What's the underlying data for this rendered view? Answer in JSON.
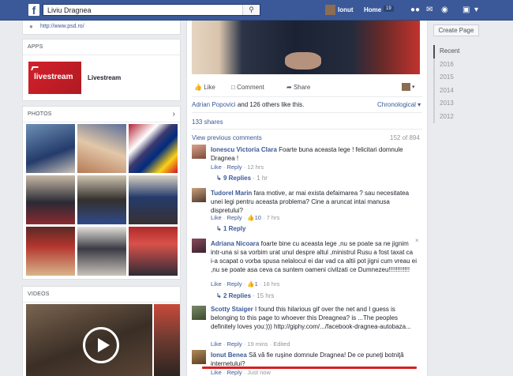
{
  "topbar": {
    "logo": "f",
    "search_value": "Liviu Dragnea",
    "user_name": "Ionut",
    "home_label": "Home",
    "home_count": "19",
    "icons": [
      "friends-icon",
      "messages-icon",
      "globe-icon",
      "lock-icon",
      "caret-down-icon"
    ]
  },
  "left": {
    "url": "http://www.psd.ro/",
    "apps_header": "APPS",
    "app_logo_text": "livestream",
    "app_name": "Livestream",
    "photos_header": "PHOTOS",
    "videos_header": "VIDEOS"
  },
  "post": {
    "actions": {
      "like": "Like",
      "comment": "Comment",
      "share": "Share"
    },
    "likers_name": "Adrian Popovici",
    "likers_rest": " and 126 others like this.",
    "order_label": "Chronological ▾",
    "shares": "133 shares",
    "view_previous": "View previous comments",
    "count": "152 of 894",
    "comments": [
      {
        "name": "Ionescu Victoria Clara",
        "text": "Foarte buna aceasta lege ! felicitari domnule Dragnea !",
        "meta_like": "Like",
        "meta_reply": "Reply",
        "meta_time": "12 hrs",
        "replies": "9 Replies",
        "replies_time": "1 hr"
      },
      {
        "name": "Tudorel Marin",
        "text": "fara motive, ar mai exista defaimarea ? sau necesitatea unei legi pentru aceasta problema? Cine a aruncat intai manusa dispretului?",
        "meta_like": "Like",
        "meta_reply": "Reply",
        "meta_likes": "10",
        "meta_time": "7 hrs",
        "replies": "1 Reply"
      },
      {
        "name": "Adriana Nicoara",
        "text": "foarte bine cu aceasta lege ,nu se poate sa ne jignim intr-una si sa vorbim urat unul despre altul ,ministrul Rusu a fost taxat ca i-a scapat o vorba spusa nelalocul ei dar vad ca altii pot jigni cum vreau ei ,nu se poate asa ceva ca suntem oameni civilzati ce Dumnezeu!!!!!!!!!!!!",
        "meta_like": "Like",
        "meta_reply": "Reply",
        "meta_likes": "1",
        "meta_time": "16 hrs",
        "replies": "2 Replies",
        "replies_time": "15 hrs"
      },
      {
        "name": "Scotty Staiger",
        "text": "I found this hilarious gif over the net and I guess is belonging to this page to whoever this Dreagnea? is ...The peoples definitely loves you:))) http://giphy.com/.../facebook-dragnea-autobaza...",
        "meta_like": "Like",
        "meta_reply": "Reply",
        "meta_time": "19 mins",
        "meta_edited": "Edited"
      },
      {
        "name": "Ionut Benea",
        "text": "Să vă fie ruşine domnule Dragnea! De ce puneţi botniţă internetului?",
        "meta_like": "Like",
        "meta_reply": "Reply",
        "meta_time": "Just now"
      }
    ]
  },
  "right": {
    "create_page": "Create Page",
    "years": [
      "Recent",
      "2016",
      "2015",
      "2014",
      "2013",
      "2012"
    ]
  },
  "colors": {
    "brand": "#3b5998",
    "background": "#e9ebee",
    "highlight_underline": "#d6201f"
  }
}
